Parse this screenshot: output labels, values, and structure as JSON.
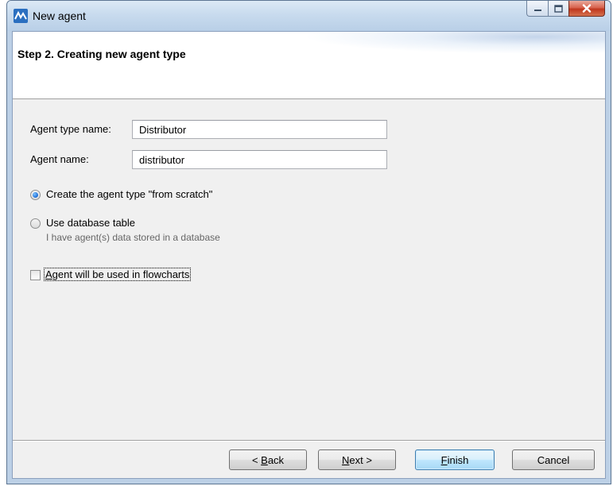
{
  "window": {
    "title": "New agent",
    "app_icon": "anylogic-logo-icon",
    "controls": [
      "minimize-icon",
      "maximize-icon",
      "close-icon"
    ]
  },
  "header": {
    "title": "Step 2. Creating new agent type"
  },
  "form": {
    "agent_type_name": {
      "label": "Agent type name:",
      "value": "Distributor"
    },
    "agent_name": {
      "label": "Agent name:",
      "value": "distributor"
    }
  },
  "options": {
    "from_scratch": {
      "label": "Create the agent type \"from scratch\"",
      "checked": true
    },
    "database_table": {
      "label": "Use database table",
      "hint": "I have agent(s) data stored in a database",
      "checked": false
    }
  },
  "flowcharts": {
    "label_mnemonic": "A",
    "label_rest": "gent will be used in flowcharts",
    "checked": false
  },
  "buttons": {
    "back": {
      "prefix": "< ",
      "mnemonic": "B",
      "rest": "ack"
    },
    "next": {
      "mnemonic": "N",
      "rest": "ext >"
    },
    "finish": {
      "mnemonic": "F",
      "rest": "inish"
    },
    "cancel": "Cancel"
  },
  "colors": {
    "title_bar": "#c8dbee",
    "close_button": "#c0371e",
    "radio_selected": "#1a6bd6",
    "default_button_border": "#3c7fb1"
  }
}
